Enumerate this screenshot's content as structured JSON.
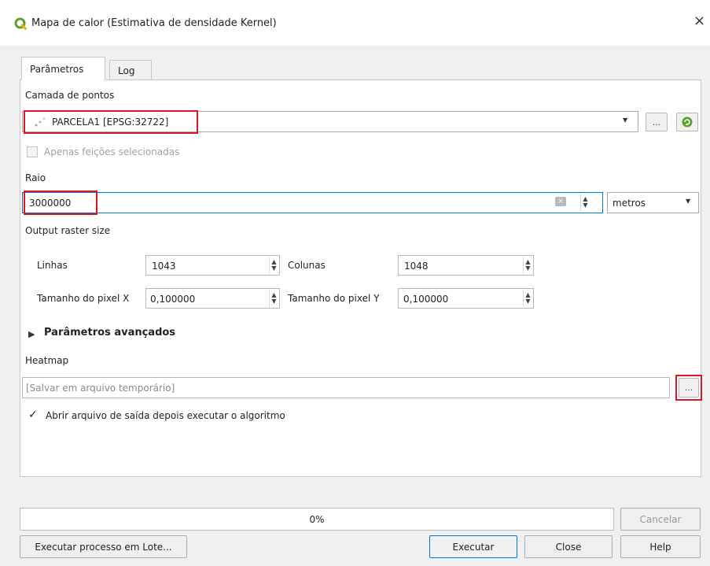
{
  "window": {
    "title": "Mapa de calor (Estimativa de densidade Kernel)",
    "close_glyph": "×"
  },
  "tabs": [
    {
      "label": "Parâmetros"
    },
    {
      "label": "Log"
    }
  ],
  "layer": {
    "label": "Camada de pontos",
    "value": "PARCELA1 [EPSG:32722]",
    "browse_label": "...",
    "selected_only_label": "Apenas feições selecionadas"
  },
  "radius": {
    "label": "Raio",
    "value": "3000000",
    "unit": "metros"
  },
  "raster": {
    "section_label": "Output raster size",
    "rows_label": "Linhas",
    "rows_value": "1043",
    "cols_label": "Colunas",
    "cols_value": "1048",
    "pixel_x_label": "Tamanho do pixel X",
    "pixel_x_value": "0,100000",
    "pixel_y_label": "Tamanho do pixel Y",
    "pixel_y_value": "0,100000"
  },
  "advanced": {
    "label": "Parâmetros avançados"
  },
  "heatmap": {
    "label": "Heatmap",
    "placeholder": "[Salvar em arquivo temporário]",
    "browse_label": "...",
    "open_output_label": "Abrir arquivo de saída depois executar o algoritmo",
    "open_output_checked": true
  },
  "progress": {
    "percent": 0,
    "text": "0%"
  },
  "buttons": {
    "cancel": "Cancelar",
    "batch": "Executar processo em Lote...",
    "run": "Executar",
    "close": "Close",
    "help": "Help"
  },
  "colors": {
    "highlight": "#e0141e",
    "focus": "#0078d7",
    "qgis_green": "#5aa02c"
  },
  "icons": {
    "logo": "qgis-logo-icon",
    "point_layer": "point-layer-icon",
    "refresh": "refresh-icon",
    "clear": "clear-field-icon",
    "expand": "triangle-right-icon",
    "check": "checkmark-icon"
  }
}
